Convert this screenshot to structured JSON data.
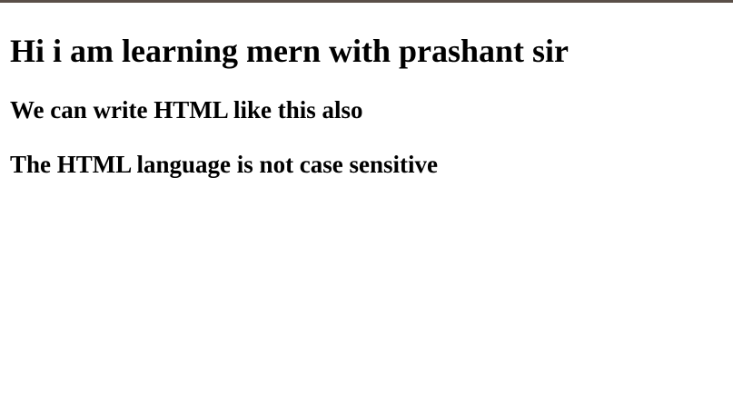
{
  "page": {
    "heading_main": "Hi i am learning mern with prashant sir",
    "heading_sub_1": "We can write HTML like this also",
    "heading_sub_2": "The HTML language is not case sensitive"
  },
  "colors": {
    "top_border": "#5a4f48",
    "background": "#ffffff",
    "text": "#000000"
  }
}
